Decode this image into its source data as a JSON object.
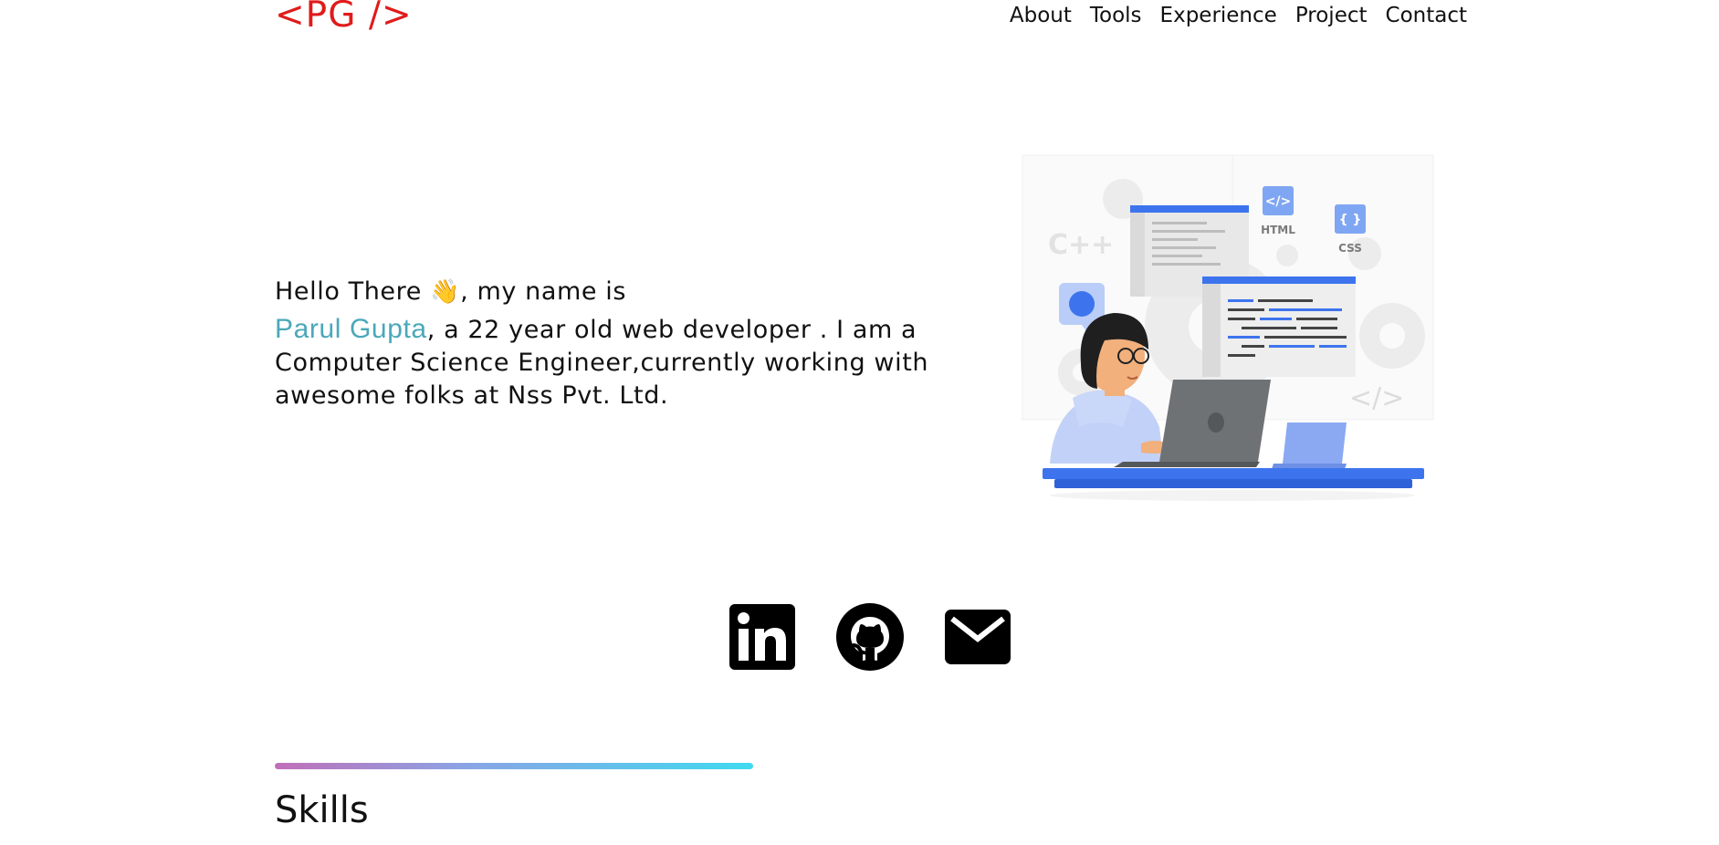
{
  "header": {
    "logo": "<PG />",
    "logo_color": "#e01b1b",
    "nav": [
      {
        "label": "About"
      },
      {
        "label": "Tools"
      },
      {
        "label": "Experience"
      },
      {
        "label": "Project"
      },
      {
        "label": "Contact"
      }
    ]
  },
  "hero": {
    "greeting": "Hello There ",
    "wave_emoji": "👋",
    "greeting_tail": ", my name is",
    "name": "Parul Gupta",
    "name_color": "#4aa8b9",
    "description": ", a 22 year old web developer . I am a Computer Science Engineer,currently working with awesome folks at Nss Pvt. Ltd.",
    "illustration": {
      "labels": {
        "html": "HTML",
        "css": "CSS",
        "cpp": "C++",
        "html_badge": "</>",
        "css_badge": "{ }",
        "code_tag": "</>"
      }
    }
  },
  "socials": [
    {
      "icon": "linkedin-icon"
    },
    {
      "icon": "github-icon"
    },
    {
      "icon": "mail-icon"
    }
  ],
  "sections": {
    "skills_title": "Skills"
  },
  "colors": {
    "accent_blue": "#3d74ee",
    "gradient_start": "#c06fb9",
    "gradient_end": "#3fdaf0"
  }
}
